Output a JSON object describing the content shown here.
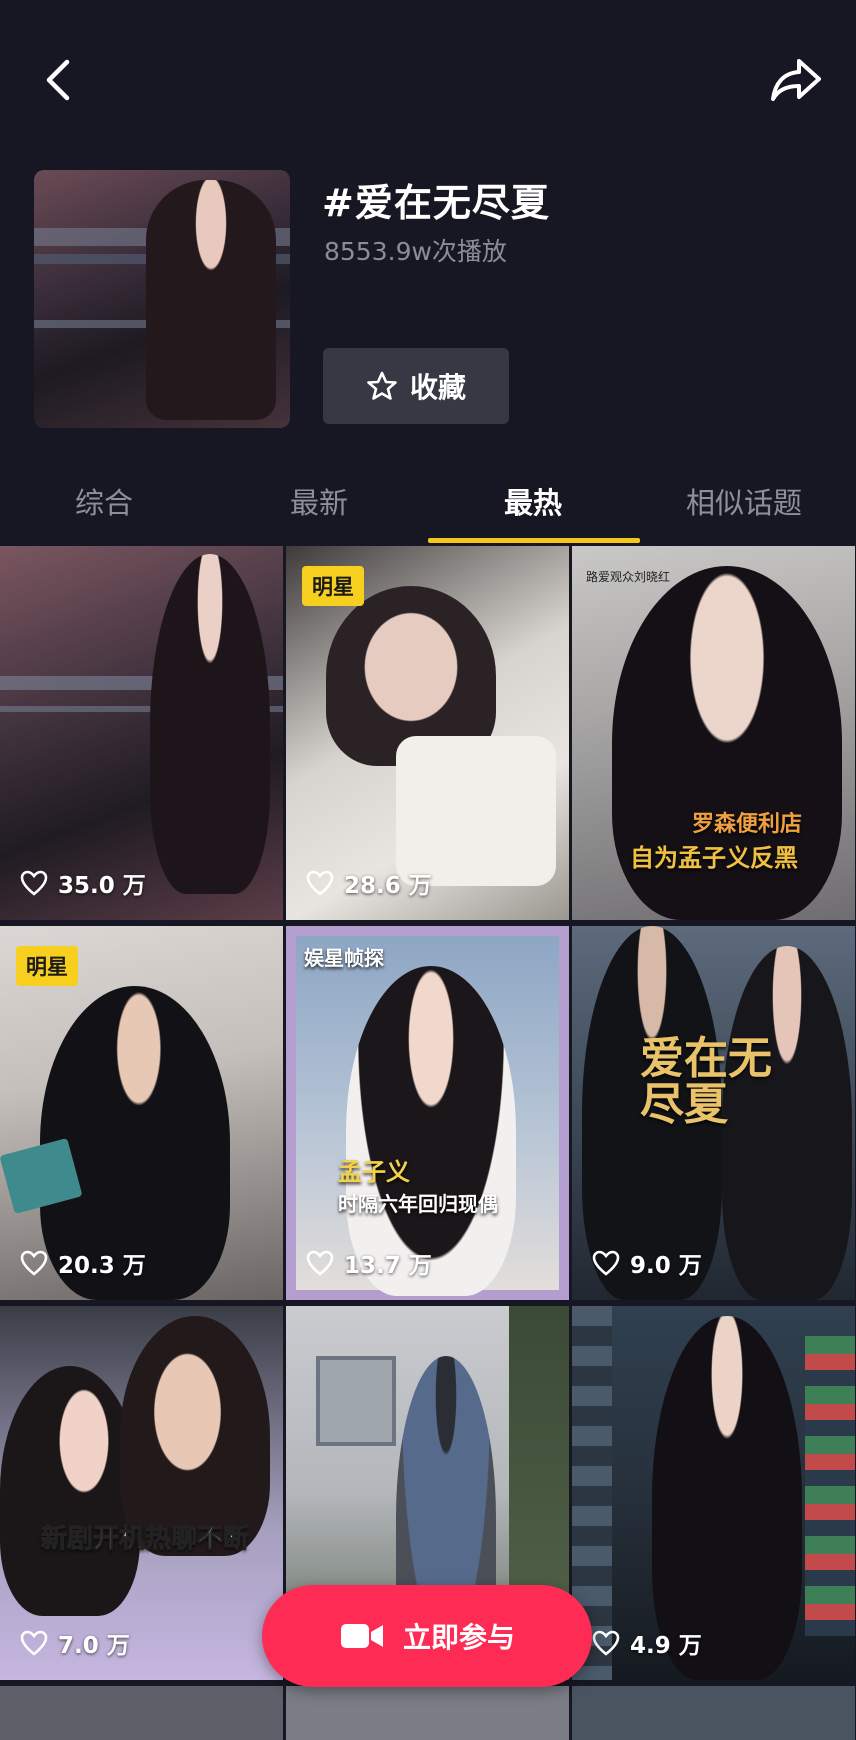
{
  "topic": {
    "title": "#爱在无尽夏",
    "play_count": "8553.9w次播放",
    "favorite_label": "收藏"
  },
  "tabs": [
    {
      "label": "综合",
      "active": false
    },
    {
      "label": "最新",
      "active": false
    },
    {
      "label": "最热",
      "active": true
    },
    {
      "label": "相似话题",
      "active": false
    }
  ],
  "videos": [
    {
      "likes": "35.0 万",
      "badge": "",
      "overlay": ""
    },
    {
      "likes": "28.6 万",
      "badge": "明星",
      "overlay": ""
    },
    {
      "likes": "",
      "badge": "",
      "overlay": "罗森便利店",
      "overlay2": "自为孟子义反黑",
      "author_mark": "路爱观众刘晓红"
    },
    {
      "likes": "20.3 万",
      "badge": "明星",
      "overlay": ""
    },
    {
      "likes": "13.7 万",
      "badge": "",
      "overlay": "娱星帧探",
      "overlay2": "孟子义",
      "overlay3": "时隔六年回归现偶"
    },
    {
      "likes": "9.0 万",
      "badge": "",
      "overlay": "爱在无尽夏"
    },
    {
      "likes": "7.0 万",
      "badge": "",
      "overlay": "新剧开机热聊不断"
    },
    {
      "likes": "",
      "badge": "",
      "overlay": ""
    },
    {
      "likes": "4.9 万",
      "badge": "",
      "overlay": ""
    }
  ],
  "cta": {
    "label": "立即参与"
  },
  "colors": {
    "background": "#161722",
    "accent_yellow": "#f5c518",
    "cta_red": "#fe2c55"
  },
  "icons": [
    "back-arrow-icon",
    "share-icon",
    "star-icon",
    "heart-icon",
    "camera-icon"
  ]
}
